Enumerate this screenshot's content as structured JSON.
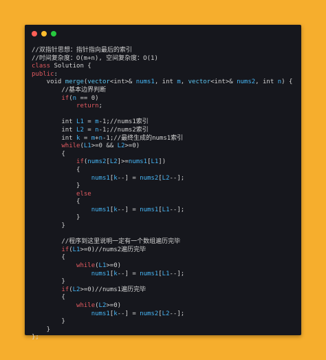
{
  "window": {
    "controls": {
      "close_color": "#ff5f56",
      "minimize_color": "#ffbd2e",
      "maximize_color": "#27c93f"
    }
  },
  "code": {
    "lines": [
      [
        {
          "t": "//双指针思想：指针指向最后的索引",
          "c": "cm"
        }
      ],
      [
        {
          "t": "//时间复杂度：O(m+n), 空间复杂度：O(1)",
          "c": "cm"
        }
      ],
      [
        {
          "t": "class",
          "c": "kw"
        },
        {
          "t": " Solution {",
          "c": "op"
        }
      ],
      [
        {
          "t": "public",
          "c": "kw"
        },
        {
          "t": ":",
          "c": "op"
        }
      ],
      [
        {
          "t": "    void ",
          "c": "op"
        },
        {
          "t": "merge",
          "c": "fn"
        },
        {
          "t": "(",
          "c": "op"
        },
        {
          "t": "vector",
          "c": "fn"
        },
        {
          "t": "<int>& ",
          "c": "op"
        },
        {
          "t": "nums1",
          "c": "pm"
        },
        {
          "t": ", int ",
          "c": "op"
        },
        {
          "t": "m",
          "c": "pm"
        },
        {
          "t": ", ",
          "c": "op"
        },
        {
          "t": "vector",
          "c": "fn"
        },
        {
          "t": "<int>& ",
          "c": "op"
        },
        {
          "t": "nums2",
          "c": "pm"
        },
        {
          "t": ", int ",
          "c": "op"
        },
        {
          "t": "n",
          "c": "pm"
        },
        {
          "t": ") {",
          "c": "op"
        }
      ],
      [
        {
          "t": "        //基本边界判断",
          "c": "cm"
        }
      ],
      [
        {
          "t": "        ",
          "c": "op"
        },
        {
          "t": "if",
          "c": "kw"
        },
        {
          "t": "(",
          "c": "op"
        },
        {
          "t": "n",
          "c": "pm"
        },
        {
          "t": " == 0)",
          "c": "op"
        }
      ],
      [
        {
          "t": "            ",
          "c": "op"
        },
        {
          "t": "return",
          "c": "kw"
        },
        {
          "t": ";",
          "c": "op"
        }
      ],
      [
        {
          "t": "",
          "c": "op"
        }
      ],
      [
        {
          "t": "        int ",
          "c": "op"
        },
        {
          "t": "L1",
          "c": "pm"
        },
        {
          "t": " = ",
          "c": "op"
        },
        {
          "t": "m",
          "c": "pm"
        },
        {
          "t": "-1;//nums1索引",
          "c": "op"
        }
      ],
      [
        {
          "t": "        int ",
          "c": "op"
        },
        {
          "t": "L2",
          "c": "pm"
        },
        {
          "t": " = ",
          "c": "op"
        },
        {
          "t": "n",
          "c": "pm"
        },
        {
          "t": "-1;//nums2索引",
          "c": "op"
        }
      ],
      [
        {
          "t": "        int ",
          "c": "op"
        },
        {
          "t": "k",
          "c": "pm"
        },
        {
          "t": " = ",
          "c": "op"
        },
        {
          "t": "m",
          "c": "pm"
        },
        {
          "t": "+",
          "c": "op"
        },
        {
          "t": "n",
          "c": "pm"
        },
        {
          "t": "-1;//最终生成的nums1索引",
          "c": "op"
        }
      ],
      [
        {
          "t": "        ",
          "c": "op"
        },
        {
          "t": "while",
          "c": "kw"
        },
        {
          "t": "(",
          "c": "op"
        },
        {
          "t": "L1",
          "c": "pm"
        },
        {
          "t": ">=0 && ",
          "c": "op"
        },
        {
          "t": "L2",
          "c": "pm"
        },
        {
          "t": ">=0)",
          "c": "op"
        }
      ],
      [
        {
          "t": "        {",
          "c": "op"
        }
      ],
      [
        {
          "t": "            ",
          "c": "op"
        },
        {
          "t": "if",
          "c": "kw"
        },
        {
          "t": "(",
          "c": "op"
        },
        {
          "t": "nums2",
          "c": "pm"
        },
        {
          "t": "[",
          "c": "op"
        },
        {
          "t": "L2",
          "c": "pm"
        },
        {
          "t": "]>=",
          "c": "op"
        },
        {
          "t": "nums1",
          "c": "pm"
        },
        {
          "t": "[",
          "c": "op"
        },
        {
          "t": "L1",
          "c": "pm"
        },
        {
          "t": "])",
          "c": "op"
        }
      ],
      [
        {
          "t": "            {",
          "c": "op"
        }
      ],
      [
        {
          "t": "                ",
          "c": "op"
        },
        {
          "t": "nums1",
          "c": "pm"
        },
        {
          "t": "[",
          "c": "op"
        },
        {
          "t": "k",
          "c": "pm"
        },
        {
          "t": "--] = ",
          "c": "op"
        },
        {
          "t": "nums2",
          "c": "pm"
        },
        {
          "t": "[",
          "c": "op"
        },
        {
          "t": "L2",
          "c": "pm"
        },
        {
          "t": "--];",
          "c": "op"
        }
      ],
      [
        {
          "t": "            }",
          "c": "op"
        }
      ],
      [
        {
          "t": "            ",
          "c": "op"
        },
        {
          "t": "else",
          "c": "kw"
        }
      ],
      [
        {
          "t": "            {",
          "c": "op"
        }
      ],
      [
        {
          "t": "                ",
          "c": "op"
        },
        {
          "t": "nums1",
          "c": "pm"
        },
        {
          "t": "[",
          "c": "op"
        },
        {
          "t": "k",
          "c": "pm"
        },
        {
          "t": "--] = ",
          "c": "op"
        },
        {
          "t": "nums1",
          "c": "pm"
        },
        {
          "t": "[",
          "c": "op"
        },
        {
          "t": "L1",
          "c": "pm"
        },
        {
          "t": "--];",
          "c": "op"
        }
      ],
      [
        {
          "t": "            }",
          "c": "op"
        }
      ],
      [
        {
          "t": "        }",
          "c": "op"
        }
      ],
      [
        {
          "t": "",
          "c": "op"
        }
      ],
      [
        {
          "t": "        //程序到这里说明一定有一个数组遍历完毕",
          "c": "cm"
        }
      ],
      [
        {
          "t": "        ",
          "c": "op"
        },
        {
          "t": "if",
          "c": "kw"
        },
        {
          "t": "(",
          "c": "op"
        },
        {
          "t": "L1",
          "c": "pm"
        },
        {
          "t": ">=0)//nums2遍历完毕",
          "c": "op"
        }
      ],
      [
        {
          "t": "        {",
          "c": "op"
        }
      ],
      [
        {
          "t": "            ",
          "c": "op"
        },
        {
          "t": "while",
          "c": "kw"
        },
        {
          "t": "(",
          "c": "op"
        },
        {
          "t": "L1",
          "c": "pm"
        },
        {
          "t": ">=0)",
          "c": "op"
        }
      ],
      [
        {
          "t": "                ",
          "c": "op"
        },
        {
          "t": "nums1",
          "c": "pm"
        },
        {
          "t": "[",
          "c": "op"
        },
        {
          "t": "k",
          "c": "pm"
        },
        {
          "t": "--] = ",
          "c": "op"
        },
        {
          "t": "nums1",
          "c": "pm"
        },
        {
          "t": "[",
          "c": "op"
        },
        {
          "t": "L1",
          "c": "pm"
        },
        {
          "t": "--];",
          "c": "op"
        }
      ],
      [
        {
          "t": "        }",
          "c": "op"
        }
      ],
      [
        {
          "t": "        ",
          "c": "op"
        },
        {
          "t": "if",
          "c": "kw"
        },
        {
          "t": "(",
          "c": "op"
        },
        {
          "t": "L2",
          "c": "pm"
        },
        {
          "t": ">=0)//nums1遍历完毕",
          "c": "op"
        }
      ],
      [
        {
          "t": "        {",
          "c": "op"
        }
      ],
      [
        {
          "t": "            ",
          "c": "op"
        },
        {
          "t": "while",
          "c": "kw"
        },
        {
          "t": "(",
          "c": "op"
        },
        {
          "t": "L2",
          "c": "pm"
        },
        {
          "t": ">=0)",
          "c": "op"
        }
      ],
      [
        {
          "t": "                ",
          "c": "op"
        },
        {
          "t": "nums1",
          "c": "pm"
        },
        {
          "t": "[",
          "c": "op"
        },
        {
          "t": "k",
          "c": "pm"
        },
        {
          "t": "--] = ",
          "c": "op"
        },
        {
          "t": "nums2",
          "c": "pm"
        },
        {
          "t": "[",
          "c": "op"
        },
        {
          "t": "L2",
          "c": "pm"
        },
        {
          "t": "--];",
          "c": "op"
        }
      ],
      [
        {
          "t": "        }",
          "c": "op"
        }
      ],
      [
        {
          "t": "    }",
          "c": "op"
        }
      ],
      [
        {
          "t": "};",
          "c": "op"
        }
      ]
    ]
  }
}
